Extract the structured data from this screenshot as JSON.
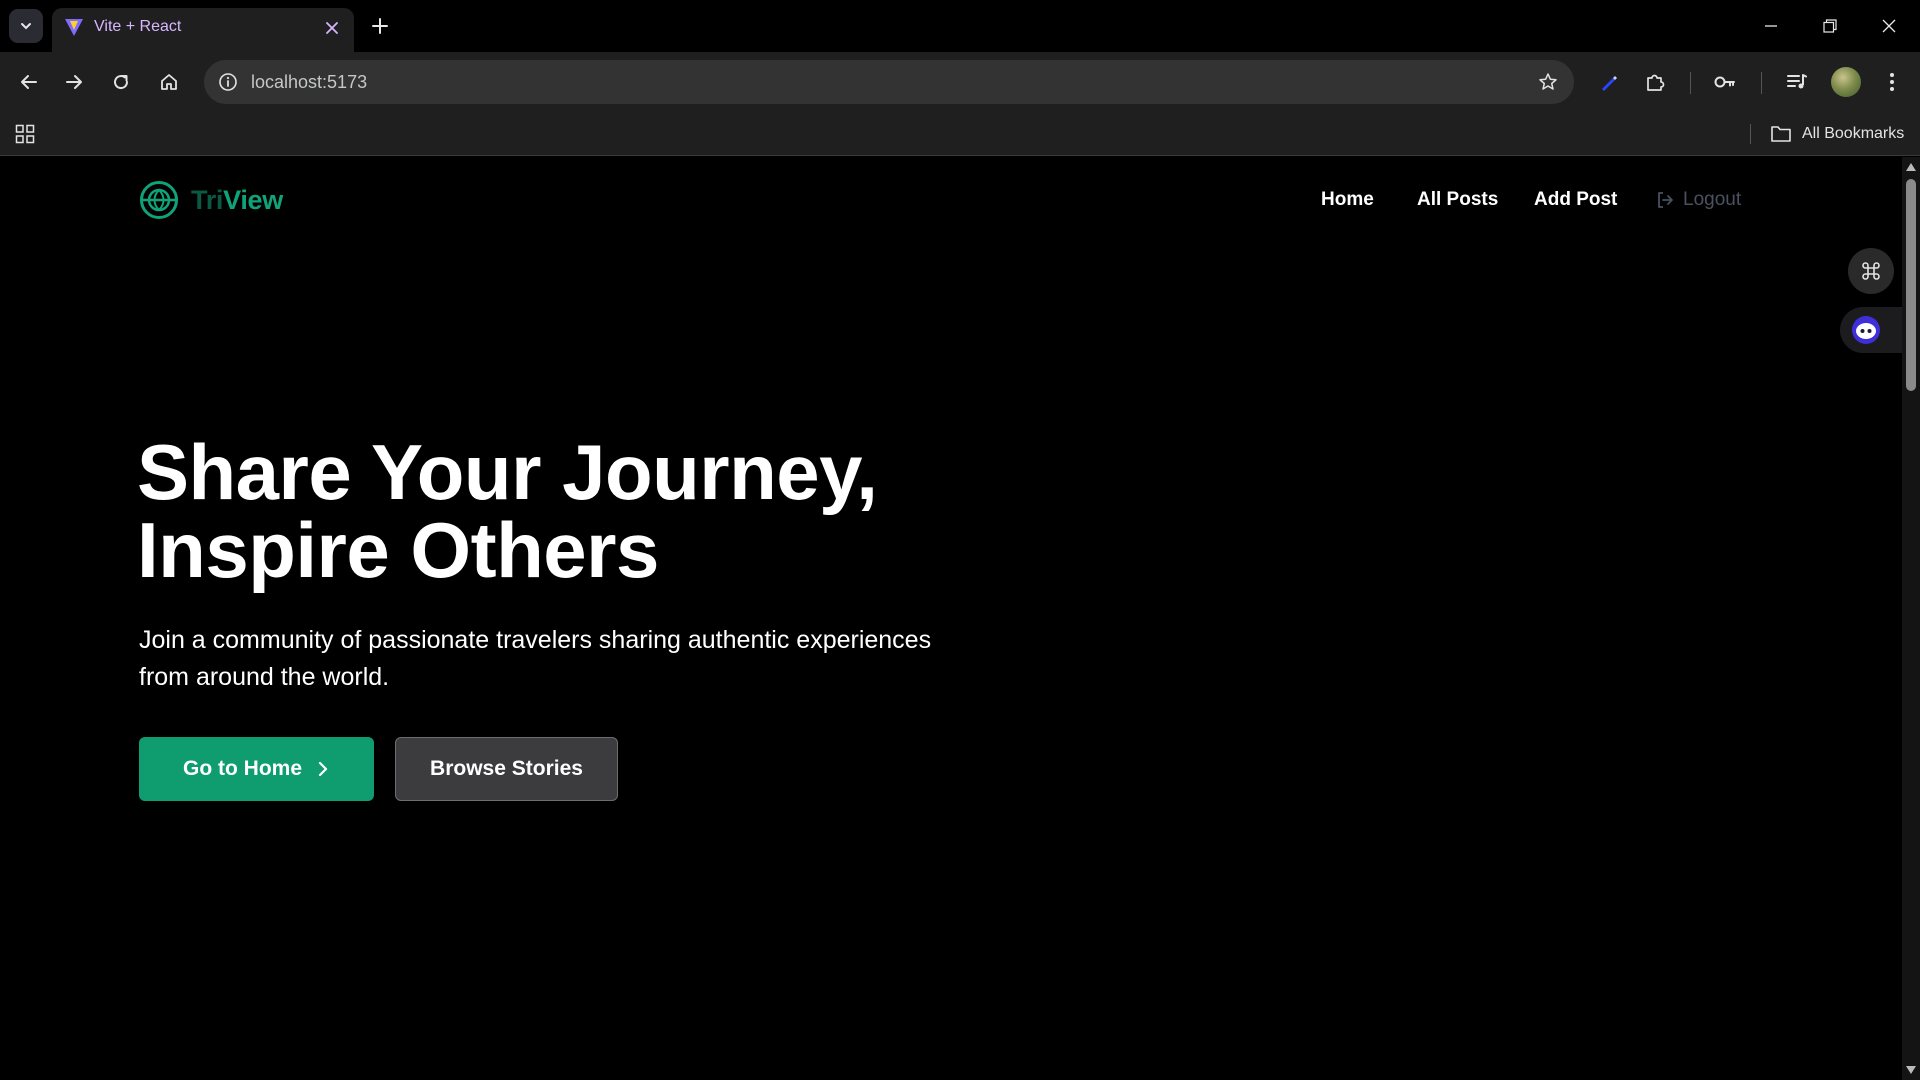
{
  "browser": {
    "tab": {
      "title": "Vite + React"
    },
    "address_bar": {
      "url": "localhost:5173"
    },
    "bookmarks_bar": {
      "all_bookmarks_label": "All Bookmarks"
    }
  },
  "site": {
    "logo": {
      "part1": "Tri",
      "part2": "View"
    },
    "nav": {
      "home": "Home",
      "all_posts": "All Posts",
      "add_post": "Add Post",
      "logout": "Logout"
    },
    "hero": {
      "title_line1": "Share Your Journey,",
      "title_line2": "Inspire Others",
      "subtitle": "Join a community of passionate travelers sharing authentic experiences from around the world.",
      "primary_button": "Go to Home",
      "secondary_button": "Browse Stories"
    }
  },
  "colors": {
    "brand_green": "#0f9d70",
    "logo_dark_green": "#0a5a43",
    "logo_green": "#10a37a",
    "tab_title": "#d7b6ff",
    "logout_muted": "#4a5160"
  }
}
